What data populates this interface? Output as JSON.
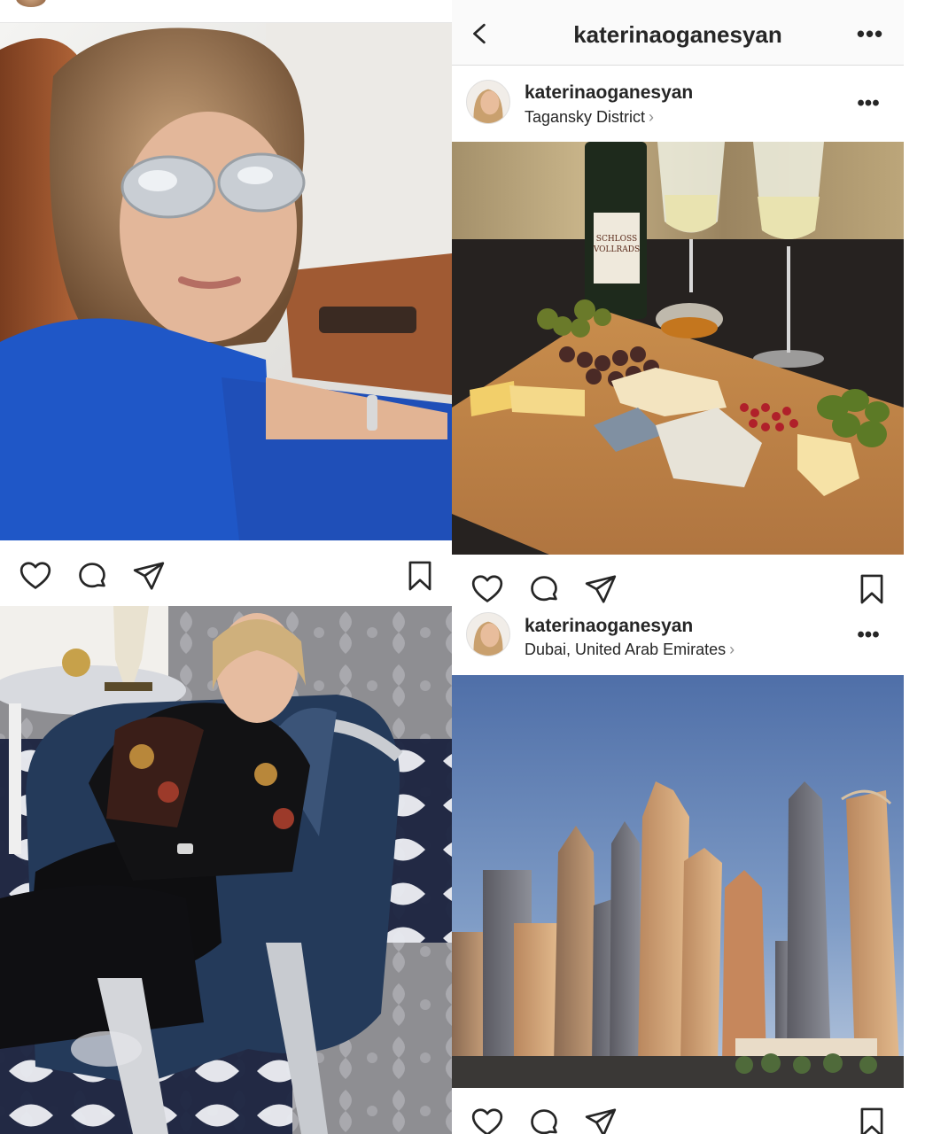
{
  "left_column": {
    "top_post": {
      "photo_alt": "selfie-in-car",
      "actions": {
        "like": "heart-icon",
        "comment": "comment-icon",
        "share": "send-icon",
        "save": "bookmark-icon"
      }
    },
    "bottom_post": {
      "photo_alt": "woman-in-armchair"
    }
  },
  "right_column": {
    "nav": {
      "back_icon": "chevron-left-icon",
      "title": "katerinaoganesyan",
      "more": "•••"
    },
    "posts": [
      {
        "username": "katerinaoganesyan",
        "location": "Tagansky District",
        "location_chevron": "›",
        "more": "•••",
        "photo_alt": "cheese-board-and-wine"
      },
      {
        "username": "katerinaoganesyan",
        "location": "Dubai, United Arab Emirates",
        "location_chevron": "›",
        "more": "•••",
        "photo_alt": "dubai-marina-skyline"
      }
    ]
  },
  "colors": {
    "text": "#262626",
    "muted": "#8e8e8e",
    "divider": "#dbdbdb",
    "nav_bg": "#fafafa"
  }
}
